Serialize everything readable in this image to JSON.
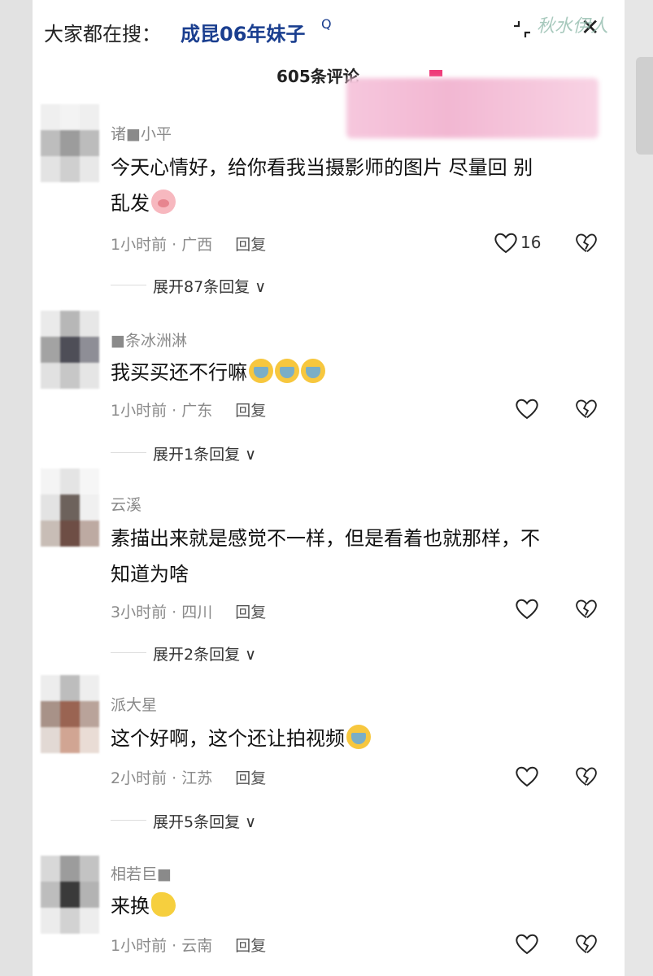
{
  "search": {
    "prefix": "大家都在搜：",
    "term": "成昆06年妹子",
    "q_mark": "Q",
    "close": "✕"
  },
  "watermark": "秋水伊人",
  "header": {
    "comment_count": "605条评论"
  },
  "comments": [
    {
      "username": "诸■小平",
      "text_lines": [
        "今天心情好，给你看我当摄影师的图片 尽量回 别",
        "乱发"
      ],
      "emoji": "pig",
      "time": "1小时前",
      "location": "广西",
      "reply": "回复",
      "likes": "16",
      "expand": "展开87条回复 ∨"
    },
    {
      "username": "■条冰洲淋",
      "text_lines": [
        "我买买还不行嘛"
      ],
      "emoji": "cry3",
      "time": "1小时前",
      "location": "广东",
      "reply": "回复",
      "likes": "",
      "expand": "展开1条回复 ∨"
    },
    {
      "username": "云溪",
      "text_lines": [
        "素描出来就是感觉不一样，但是看着也就那样，不",
        "知道为啥"
      ],
      "emoji": "",
      "time": "3小时前",
      "location": "四川",
      "reply": "回复",
      "likes": "",
      "expand": "展开2条回复 ∨"
    },
    {
      "username": "派大星",
      "text_lines": [
        "这个好啊，这个还让拍视频"
      ],
      "emoji": "cry1",
      "time": "2小时前",
      "location": "江苏",
      "reply": "回复",
      "likes": "",
      "expand": "展开5条回复 ∨"
    },
    {
      "username": "相若巨■",
      "text_lines": [
        "来换"
      ],
      "emoji": "hand",
      "time": "1小时前",
      "location": "云南",
      "reply": "回复",
      "likes": "",
      "expand": ""
    }
  ]
}
